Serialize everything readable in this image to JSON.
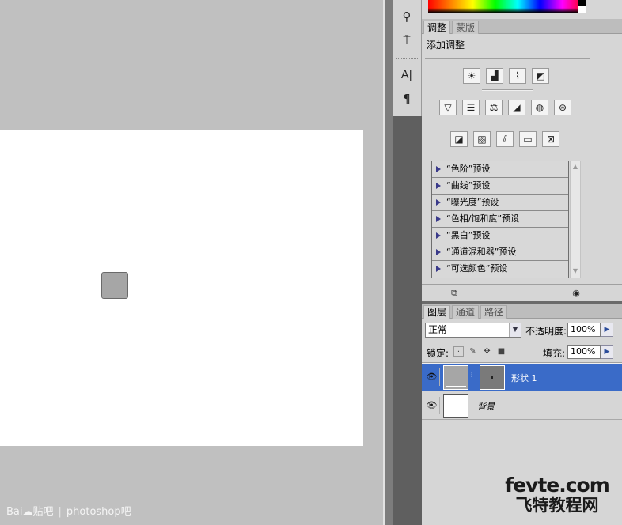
{
  "tools": {
    "items": [
      {
        "name": "clone-stamp-tool",
        "glyph": "⚲"
      },
      {
        "name": "history-brush-tool",
        "glyph": "⍑"
      },
      {
        "name": "character-panel-tool",
        "glyph": "A|"
      },
      {
        "name": "paragraph-panel-tool",
        "glyph": "¶"
      }
    ]
  },
  "adjustments": {
    "tabs": [
      {
        "label": "调整",
        "active": true
      },
      {
        "label": "蒙版",
        "active": false
      }
    ],
    "title": "添加调整",
    "icon_rows": [
      [
        "brightness-contrast-icon",
        "levels-icon",
        "curves-icon",
        "exposure-icon"
      ],
      [
        "vibrance-icon",
        "hue-saturation-icon",
        "color-balance-icon",
        "black-white-icon",
        "photo-filter-icon",
        "channel-mixer-icon"
      ],
      [
        "invert-icon",
        "posterize-icon",
        "threshold-icon",
        "gradient-map-icon",
        "selective-color-icon"
      ]
    ],
    "presets": [
      "“色阶”预设",
      "“曲线”预设",
      "“曝光度”预设",
      "“色相/饱和度”预设",
      "“黑白”预设",
      "“通道混和器”预设",
      "“可选颜色”预设"
    ]
  },
  "layers": {
    "tabs": [
      {
        "label": "图层",
        "active": true
      },
      {
        "label": "通道",
        "active": false
      },
      {
        "label": "路径",
        "active": false
      }
    ],
    "blend_mode": "正常",
    "opacity_label": "不透明度:",
    "opacity_value": "100%",
    "lock_label": "锁定:",
    "fill_label": "填充:",
    "fill_value": "100%",
    "list": [
      {
        "name": "形状 1",
        "selected": true
      },
      {
        "name": "背景",
        "selected": false
      }
    ]
  },
  "watermarks": {
    "left_brand": "Bai",
    "left_paw": "☁",
    "left_site": "贴吧",
    "left_sep": "|",
    "left_forum": "photoshop吧",
    "brand_top": "fevte.com",
    "brand_bottom": "飞特教程网"
  },
  "colors": {
    "selection": "#3a6bc8",
    "panel_bg": "#d6d6d6",
    "canvas_bg": "#c0c0c0"
  }
}
